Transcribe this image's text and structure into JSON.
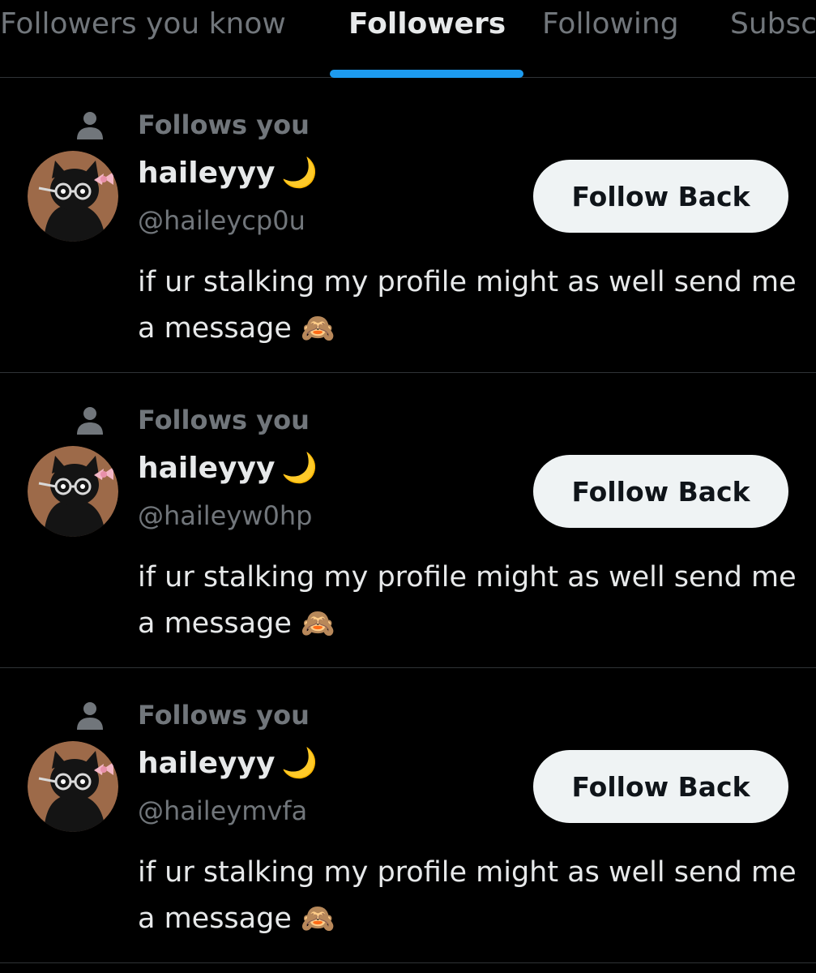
{
  "tabs": [
    {
      "label": "Followers you know"
    },
    {
      "label": "Followers"
    },
    {
      "label": "Following"
    },
    {
      "label": "Subsc"
    }
  ],
  "active_tab": "Followers",
  "accent_color": "#1d9bf0",
  "follows_icon": "person-icon",
  "followers": [
    {
      "follows_label": "Follows you",
      "display_name": "haileyyy",
      "name_emoji": "🌙",
      "handle": "@haileycp0u",
      "button_label": "Follow Back",
      "bio": "if ur stalking my profile might as well send me a message",
      "bio_emoji": "🙈"
    },
    {
      "follows_label": "Follows you",
      "display_name": "haileyyy",
      "name_emoji": "🌙",
      "handle": "@haileyw0hp",
      "button_label": "Follow Back",
      "bio": "if ur stalking my profile might as well send me a message",
      "bio_emoji": "🙈"
    },
    {
      "follows_label": "Follows you",
      "display_name": "haileyyy",
      "name_emoji": "🌙",
      "handle": "@haileymvfa",
      "button_label": "Follow Back",
      "bio": "if ur stalking my profile might as well send me a message",
      "bio_emoji": "🙈"
    }
  ]
}
